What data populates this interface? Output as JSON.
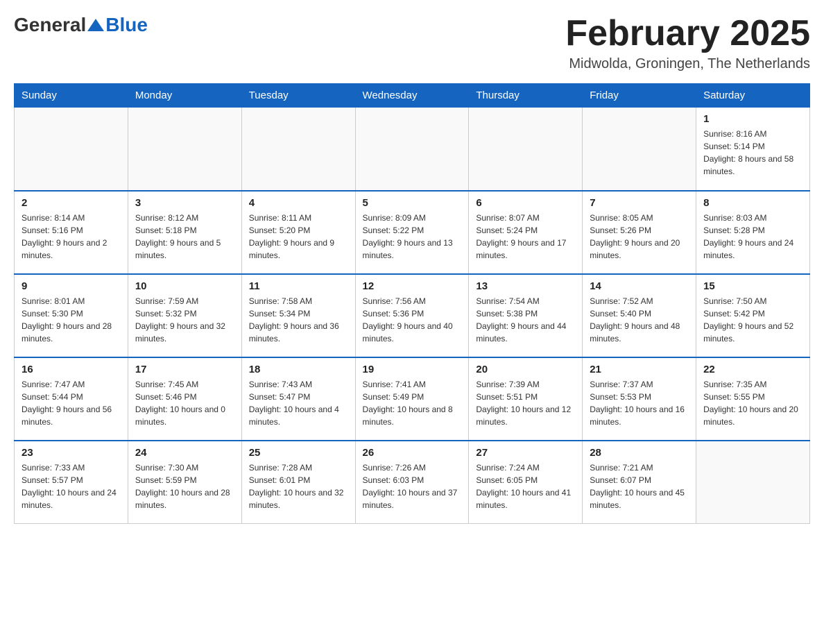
{
  "header": {
    "logo_general": "General",
    "logo_blue": "Blue",
    "title": "February 2025",
    "subtitle": "Midwolda, Groningen, The Netherlands"
  },
  "days_of_week": [
    "Sunday",
    "Monday",
    "Tuesday",
    "Wednesday",
    "Thursday",
    "Friday",
    "Saturday"
  ],
  "weeks": [
    [
      {
        "day": "",
        "info": ""
      },
      {
        "day": "",
        "info": ""
      },
      {
        "day": "",
        "info": ""
      },
      {
        "day": "",
        "info": ""
      },
      {
        "day": "",
        "info": ""
      },
      {
        "day": "",
        "info": ""
      },
      {
        "day": "1",
        "info": "Sunrise: 8:16 AM\nSunset: 5:14 PM\nDaylight: 8 hours and 58 minutes."
      }
    ],
    [
      {
        "day": "2",
        "info": "Sunrise: 8:14 AM\nSunset: 5:16 PM\nDaylight: 9 hours and 2 minutes."
      },
      {
        "day": "3",
        "info": "Sunrise: 8:12 AM\nSunset: 5:18 PM\nDaylight: 9 hours and 5 minutes."
      },
      {
        "day": "4",
        "info": "Sunrise: 8:11 AM\nSunset: 5:20 PM\nDaylight: 9 hours and 9 minutes."
      },
      {
        "day": "5",
        "info": "Sunrise: 8:09 AM\nSunset: 5:22 PM\nDaylight: 9 hours and 13 minutes."
      },
      {
        "day": "6",
        "info": "Sunrise: 8:07 AM\nSunset: 5:24 PM\nDaylight: 9 hours and 17 minutes."
      },
      {
        "day": "7",
        "info": "Sunrise: 8:05 AM\nSunset: 5:26 PM\nDaylight: 9 hours and 20 minutes."
      },
      {
        "day": "8",
        "info": "Sunrise: 8:03 AM\nSunset: 5:28 PM\nDaylight: 9 hours and 24 minutes."
      }
    ],
    [
      {
        "day": "9",
        "info": "Sunrise: 8:01 AM\nSunset: 5:30 PM\nDaylight: 9 hours and 28 minutes."
      },
      {
        "day": "10",
        "info": "Sunrise: 7:59 AM\nSunset: 5:32 PM\nDaylight: 9 hours and 32 minutes."
      },
      {
        "day": "11",
        "info": "Sunrise: 7:58 AM\nSunset: 5:34 PM\nDaylight: 9 hours and 36 minutes."
      },
      {
        "day": "12",
        "info": "Sunrise: 7:56 AM\nSunset: 5:36 PM\nDaylight: 9 hours and 40 minutes."
      },
      {
        "day": "13",
        "info": "Sunrise: 7:54 AM\nSunset: 5:38 PM\nDaylight: 9 hours and 44 minutes."
      },
      {
        "day": "14",
        "info": "Sunrise: 7:52 AM\nSunset: 5:40 PM\nDaylight: 9 hours and 48 minutes."
      },
      {
        "day": "15",
        "info": "Sunrise: 7:50 AM\nSunset: 5:42 PM\nDaylight: 9 hours and 52 minutes."
      }
    ],
    [
      {
        "day": "16",
        "info": "Sunrise: 7:47 AM\nSunset: 5:44 PM\nDaylight: 9 hours and 56 minutes."
      },
      {
        "day": "17",
        "info": "Sunrise: 7:45 AM\nSunset: 5:46 PM\nDaylight: 10 hours and 0 minutes."
      },
      {
        "day": "18",
        "info": "Sunrise: 7:43 AM\nSunset: 5:47 PM\nDaylight: 10 hours and 4 minutes."
      },
      {
        "day": "19",
        "info": "Sunrise: 7:41 AM\nSunset: 5:49 PM\nDaylight: 10 hours and 8 minutes."
      },
      {
        "day": "20",
        "info": "Sunrise: 7:39 AM\nSunset: 5:51 PM\nDaylight: 10 hours and 12 minutes."
      },
      {
        "day": "21",
        "info": "Sunrise: 7:37 AM\nSunset: 5:53 PM\nDaylight: 10 hours and 16 minutes."
      },
      {
        "day": "22",
        "info": "Sunrise: 7:35 AM\nSunset: 5:55 PM\nDaylight: 10 hours and 20 minutes."
      }
    ],
    [
      {
        "day": "23",
        "info": "Sunrise: 7:33 AM\nSunset: 5:57 PM\nDaylight: 10 hours and 24 minutes."
      },
      {
        "day": "24",
        "info": "Sunrise: 7:30 AM\nSunset: 5:59 PM\nDaylight: 10 hours and 28 minutes."
      },
      {
        "day": "25",
        "info": "Sunrise: 7:28 AM\nSunset: 6:01 PM\nDaylight: 10 hours and 32 minutes."
      },
      {
        "day": "26",
        "info": "Sunrise: 7:26 AM\nSunset: 6:03 PM\nDaylight: 10 hours and 37 minutes."
      },
      {
        "day": "27",
        "info": "Sunrise: 7:24 AM\nSunset: 6:05 PM\nDaylight: 10 hours and 41 minutes."
      },
      {
        "day": "28",
        "info": "Sunrise: 7:21 AM\nSunset: 6:07 PM\nDaylight: 10 hours and 45 minutes."
      },
      {
        "day": "",
        "info": ""
      }
    ]
  ]
}
